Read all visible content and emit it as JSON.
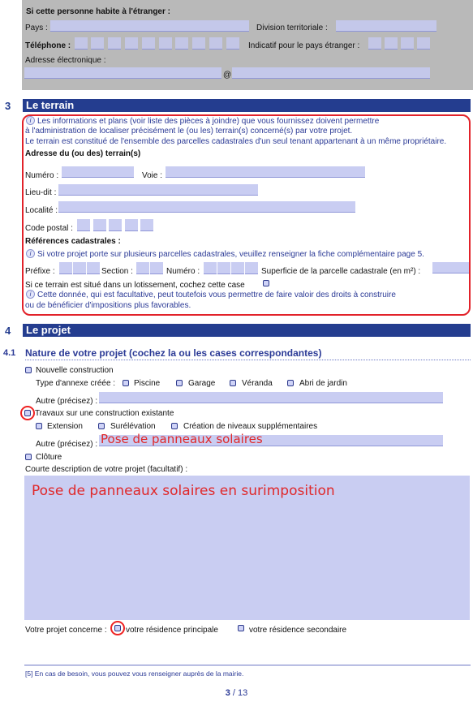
{
  "top": {
    "title": "Si cette personne habite à l'étranger :",
    "pays": "Pays :",
    "division": "Division territoriale :",
    "telephone": "Téléphone :",
    "indicatif": "Indicatif pour le pays étranger :",
    "adresse": "Adresse électronique :",
    "at": "@"
  },
  "section3": {
    "num": "3",
    "title": "Le terrain",
    "info1": "Les informations et plans (voir liste des pièces à joindre) que vous fournissez doivent permettre",
    "info2": "à l'administration de localiser précisément le (ou les) terrain(s) concerné(s) par votre projet.",
    "info3": "Le terrain est constitué de l'ensemble des parcelles cadastrales d'un seul tenant appartenant à un même propriétaire.",
    "adresse_title": "Adresse du (ou des) terrain(s)",
    "numero": "Numéro :",
    "voie": "Voie :",
    "lieudit": "Lieu-dit :",
    "localite": "Localité :",
    "cp": "Code postal :",
    "refs_title": "Références cadastrales :",
    "refs_info": "Si votre projet porte sur plusieurs parcelles cadastrales, veuillez renseigner la fiche complémentaire page 5.",
    "prefixe": "Préfixe :",
    "section": "Section :",
    "numero2": "Numéro :",
    "superficie": "Superficie de la parcelle cadastrale (en m²) :",
    "lotissement": "Si ce terrain est situé dans un lotissement, cochez cette case",
    "lot_info1": "Cette donnée, qui est facultative, peut toutefois vous permettre de faire valoir des droits à construire",
    "lot_info2": "ou de bénéficier d'impositions plus favorables."
  },
  "section4": {
    "num": "4",
    "title": "Le projet",
    "sub_num": "4.1",
    "sub_title": "Nature de votre projet (cochez la ou les cases correspondantes)",
    "nouvelle": "Nouvelle construction",
    "type_annexe": "Type d'annexe créée :",
    "piscine": "Piscine",
    "garage": "Garage",
    "veranda": "Véranda",
    "abri": "Abri de jardin",
    "autre1": "Autre (précisez) :",
    "travaux": "Travaux sur une construction existante",
    "extension": "Extension",
    "surelevation": "Surélévation",
    "niveaux": "Création de niveaux supplémentaires",
    "autre2": "Autre (précisez) :",
    "autre2_value": "Pose de panneaux solaires",
    "cloture": "Clôture",
    "courte": "Courte description de votre projet (facultatif) :",
    "description_value": "Pose de panneaux solaires en surimposition",
    "concerne": "Votre projet concerne :",
    "principale": "votre résidence principale",
    "secondaire": "votre résidence secondaire"
  },
  "footnote": "[5]  En cas de besoin, vous pouvez vous renseigner auprès de la mairie.",
  "page": {
    "current": "3",
    "sep": " / ",
    "total": "13"
  },
  "info_glyph": "i"
}
